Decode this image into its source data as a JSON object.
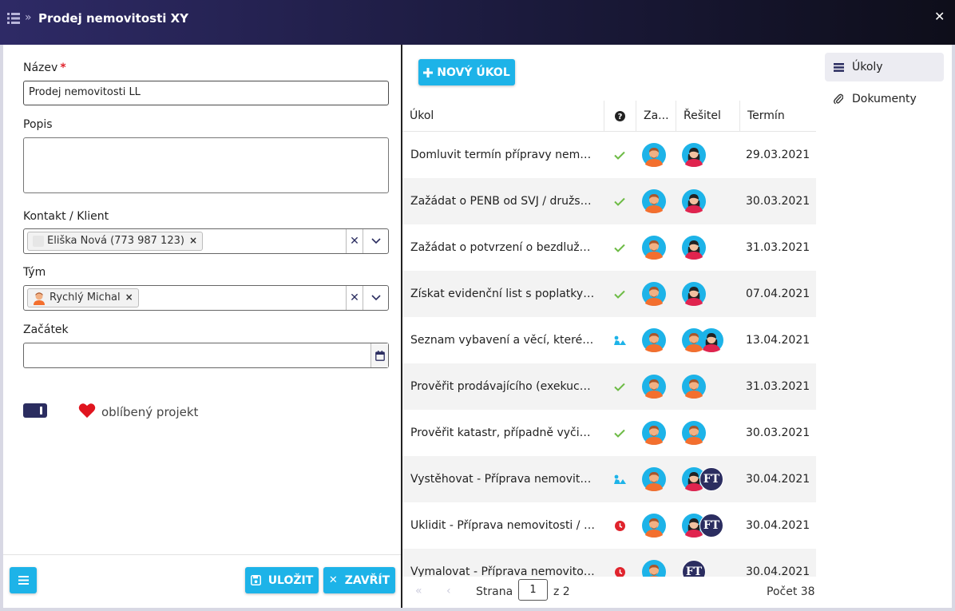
{
  "window": {
    "title": "Prodej nemovitosti XY"
  },
  "form": {
    "name_label": "Název",
    "name_required_mark": "*",
    "name_value": "Prodej nemovitosti LL",
    "description_label": "Popis",
    "contact_label": "Kontakt / Klient",
    "contact_chip": "Eliška Nová (773 987 123)",
    "team_label": "Tým",
    "team_chip": "Rychlý Michal",
    "start_label": "Začátek",
    "favorite_label": "oblíbený projekt",
    "chip_remove": "×",
    "clear_glyph": "✕"
  },
  "footer": {
    "save_label": "ULOŽIT",
    "close_label": "ZAVŘÍT"
  },
  "tasks": {
    "new_task_label": "NOVÝ ÚKOL",
    "columns": {
      "task": "Úkol",
      "status_icon": "?",
      "assignee": "Za...",
      "solver": "Řešitel",
      "deadline": "Termín"
    },
    "rows": [
      {
        "name": "Domluvit termín přípravy nemovitosti",
        "status": "done",
        "solvers": [
          "woman"
        ],
        "date": "29.03.2021"
      },
      {
        "name": "Zažádat o PENB od SVJ / družstva",
        "status": "done",
        "solvers": [
          "woman"
        ],
        "date": "30.03.2021"
      },
      {
        "name": "Zažádat o potvrzení o bezdlužnosti",
        "status": "done",
        "solvers": [
          "woman"
        ],
        "date": "31.03.2021"
      },
      {
        "name": "Získat evidenční list s poplatky za byt",
        "status": "done",
        "solvers": [
          "woman"
        ],
        "date": "07.04.2021"
      },
      {
        "name": "Seznam vybavení a věcí, které zůstanou",
        "status": "in-progress",
        "solvers": [
          "man",
          "woman"
        ],
        "date": "13.04.2021"
      },
      {
        "name": "Prověřit prodávajícího (exekuce, SVJ)",
        "status": "done",
        "solvers": [
          "man"
        ],
        "date": "31.03.2021"
      },
      {
        "name": "Prověřit katastr, případně vyčistit",
        "status": "done",
        "solvers": [
          "man"
        ],
        "date": "30.03.2021"
      },
      {
        "name": "Vystěhovat - Příprava nemovitosti",
        "status": "in-progress",
        "solvers": [
          "woman",
          "ft"
        ],
        "date": "30.04.2021"
      },
      {
        "name": "Uklidit - Příprava nemovitosti / Home staging",
        "status": "overdue",
        "solvers": [
          "woman",
          "ft"
        ],
        "date": "30.04.2021"
      },
      {
        "name": "Vymalovat - Příprava nemovitosti",
        "status": "overdue",
        "solvers": [
          "ft"
        ],
        "date": "30.04.2021"
      }
    ],
    "ft_initials": "FT"
  },
  "pager": {
    "page_label": "Strana",
    "page_value": "1",
    "of_label": "z 2",
    "count_label": "Počet 38"
  },
  "side_nav": {
    "tasks_label": "Úkoly",
    "documents_label": "Dokumenty"
  },
  "colors": {
    "accent": "#1db3e8",
    "dark": "#2b2d60",
    "done": "#6dbb45",
    "overdue": "#e0242d"
  }
}
